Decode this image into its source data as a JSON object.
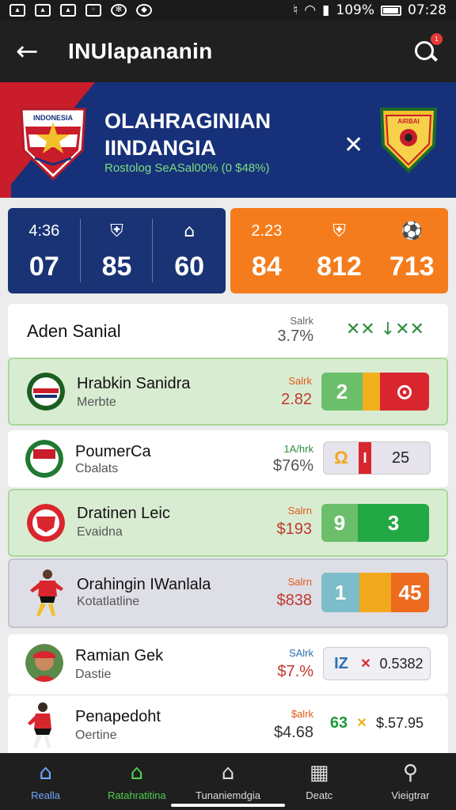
{
  "status_bar": {
    "battery": "109%",
    "time": "07:28"
  },
  "app_bar": {
    "title": "INUlapananin"
  },
  "hero": {
    "title_line1": "OLAHRAGINIAN",
    "title_line2": "IINDANGIA",
    "subtitle": "Rostolog SeASal00% (0 $48%)",
    "crest_left_text": "INDONESIA",
    "crest_right_text": "AIRBAI",
    "vs_symbol": "✕"
  },
  "stats": {
    "left": [
      {
        "top": "4:36",
        "value": "07"
      },
      {
        "top": "",
        "value": "85"
      },
      {
        "top": "",
        "value": "60"
      }
    ],
    "right": [
      {
        "top": "2.23",
        "value": "84"
      },
      {
        "top": "",
        "value": "812"
      },
      {
        "top": "",
        "value": "713"
      }
    ]
  },
  "list": {
    "header": {
      "title": "Aden Sanial",
      "label": "Salrk",
      "value": "3.7%",
      "icons": "✕✕ ↓✕✕"
    },
    "rows": [
      {
        "title": "Hrabkin Sanidra",
        "sub": "Merbte",
        "label": "Salrk",
        "value": "2.82",
        "seg1": "2",
        "seg2": "",
        "seg3": "⊙"
      },
      {
        "title": "PoumerCa",
        "sub": "Cbalats",
        "label": "1A/hrk",
        "value": "$76%",
        "seg1": "Ω",
        "seg2": "I",
        "seg3": "25"
      },
      {
        "title": "Dratinen Leic",
        "sub": "Evaidna",
        "label": "Salrn",
        "value": "$193",
        "seg1": "9",
        "seg2": "3",
        "seg3": ""
      },
      {
        "title": "Orahingin IWanlala",
        "sub": "Kotatlatline",
        "label": "Salrn",
        "value": "$838",
        "seg1": "1",
        "seg2": "",
        "seg3": "45"
      },
      {
        "title": "Ramian Gek",
        "sub": "Dastie",
        "label": "SAlrk",
        "value": "$7.%",
        "seg1": "IZ",
        "seg2": "✕",
        "seg3": "0.5382"
      },
      {
        "title": "Penapedoht",
        "sub": "Oertine",
        "label": "$alrk",
        "value": "$4.68",
        "seg1": "63",
        "seg2": "✕",
        "seg3": "$.57.95"
      }
    ]
  },
  "bottom_nav": [
    {
      "label": "Realla",
      "icon": "home-icon",
      "glyph": "⌂"
    },
    {
      "label": "Ratahratitina",
      "icon": "trophy-icon",
      "glyph": "⌂"
    },
    {
      "label": "Tunaniemdgia",
      "icon": "stadium-icon",
      "glyph": "⌂"
    },
    {
      "label": "Deatc",
      "icon": "map-icon",
      "glyph": "▦"
    },
    {
      "label": "Vieigtrar",
      "icon": "search-icon",
      "glyph": "⚲"
    }
  ]
}
